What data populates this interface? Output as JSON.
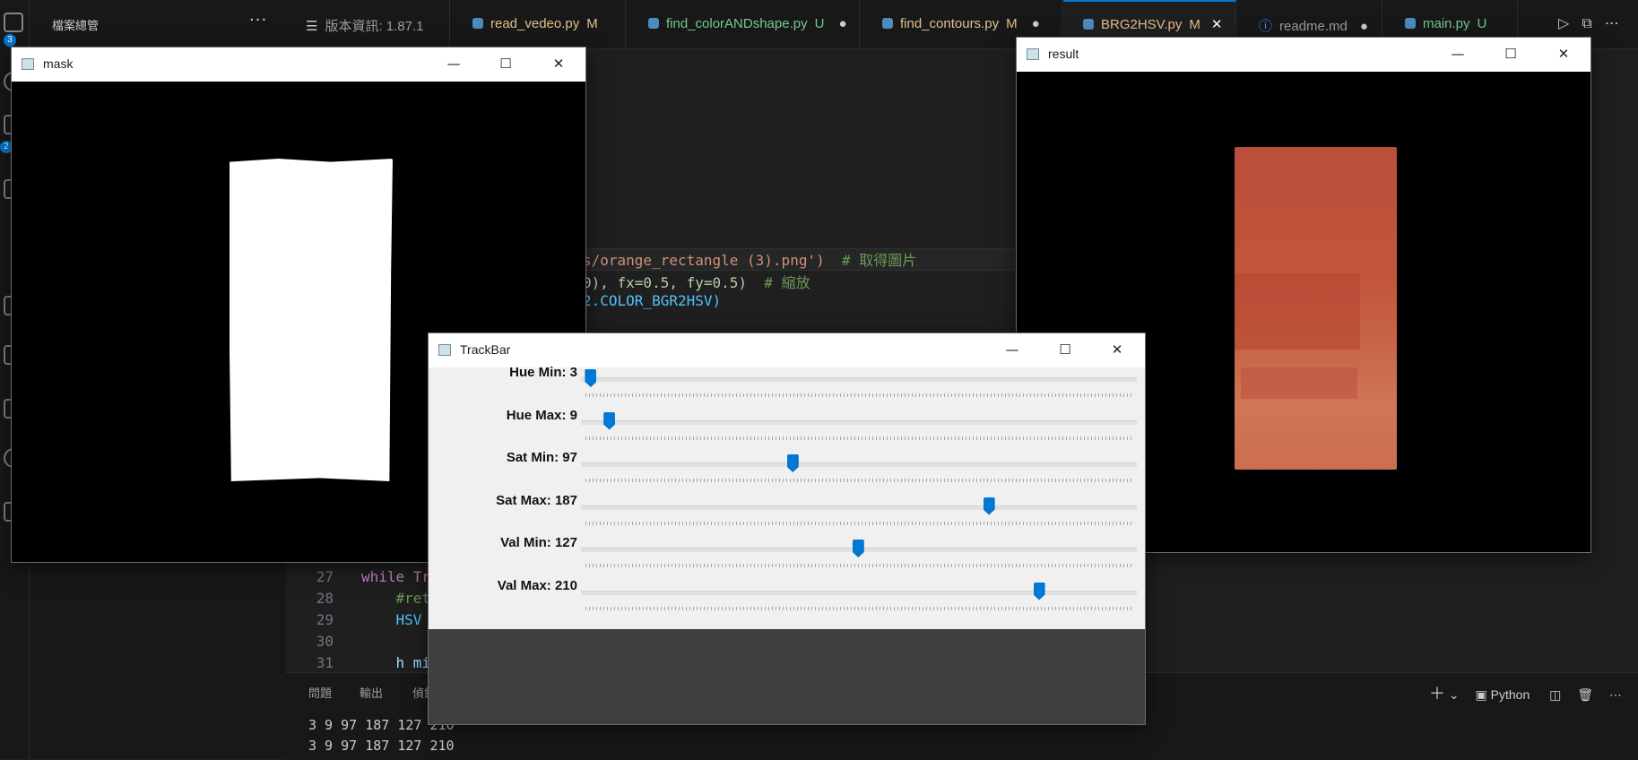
{
  "sidebar": {
    "title": "檔案總管",
    "more": "···",
    "badges": [
      "3",
      "2"
    ]
  },
  "tabs": [
    {
      "label": "版本資訊: 1.87.1",
      "status": "",
      "icon": "version-icon",
      "color": "#cccccc"
    },
    {
      "label": "read_vedeo.py",
      "status": "M",
      "icon": "python-file-icon",
      "color": "#e2c08d"
    },
    {
      "label": "find_colorANDshape.py",
      "status": "U",
      "icon": "python-file-icon",
      "color": "#73c991"
    },
    {
      "label": "find_contours.py",
      "status": "M",
      "icon": "python-file-icon",
      "color": "#e2c08d"
    },
    {
      "label": "BRG2HSV.py",
      "status": "M",
      "icon": "python-file-icon",
      "color": "#e2c08d",
      "active": true
    },
    {
      "label": "readme.md",
      "status": "",
      "icon": "info-icon",
      "color": "#cccccc"
    },
    {
      "label": "main.py",
      "status": "U",
      "icon": "python-file-icon",
      "color": "#73c991"
    }
  ],
  "editor": {
    "upper_lines": [
      {
        "text": "s/orange_rectangle (3).png')",
        "comment": "  # 取得圖片"
      },
      {
        "text": "0), fx=0.5, fy=0.5)",
        "comment": "  # 縮放"
      },
      {
        "text": "2.COLOR_BGR2HSV)",
        "comment": ""
      }
    ],
    "lower_lines": [
      {
        "num": "27",
        "text": "while Tr"
      },
      {
        "num": "28",
        "text": "    #ret"
      },
      {
        "num": "29",
        "text": "    HSV"
      },
      {
        "num": "30",
        "text": ""
      },
      {
        "num": "31",
        "text": "    h mi"
      }
    ]
  },
  "panel": {
    "tabs": [
      "問題",
      "輸出",
      "偵錯"
    ],
    "output": [
      "3 9 97 187 127 210",
      "3 9 97 187 127 210"
    ],
    "terminal_label": "Python"
  },
  "windows": {
    "mask": {
      "title": "mask"
    },
    "result": {
      "title": "result"
    },
    "trackbar": {
      "title": "TrackBar"
    }
  },
  "trackbars": [
    {
      "label": "Hue Min: 3",
      "value": 3,
      "max": 179
    },
    {
      "label": "Hue Max: 9",
      "value": 9,
      "max": 179
    },
    {
      "label": "Sat Min: 97",
      "value": 97,
      "max": 255
    },
    {
      "label": "Sat Max: 187",
      "value": 187,
      "max": 255
    },
    {
      "label": "Val Min: 127",
      "value": 127,
      "max": 255
    },
    {
      "label": "Val Max: 210",
      "value": 210,
      "max": 255
    }
  ],
  "colors": {
    "accent": "#0078d4",
    "rect_orange": "#c2553c"
  }
}
